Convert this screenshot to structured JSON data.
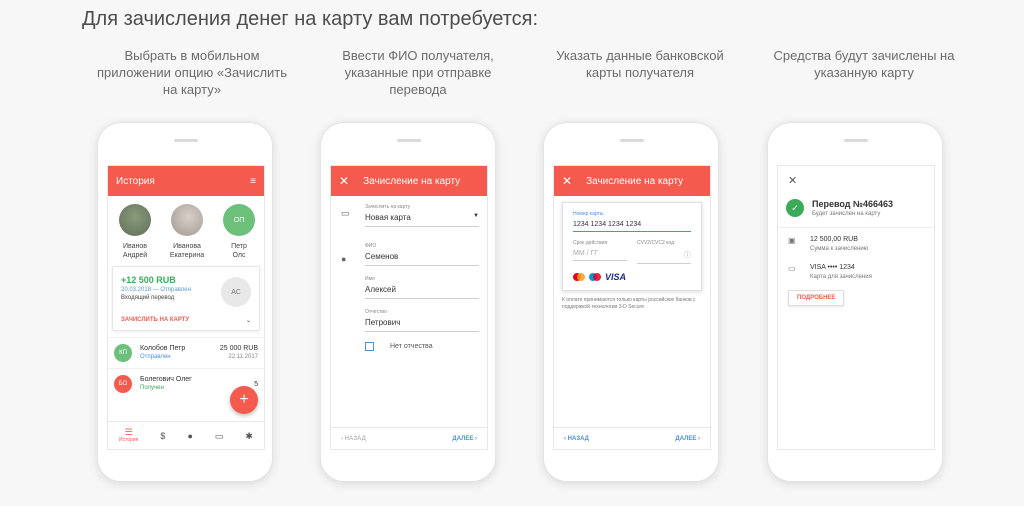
{
  "headline": "Для зачисления денег на карту вам потребуется:",
  "steps": [
    "Выбрать в мобильном приложении опцию «Зачислить на карту»",
    "Ввести ФИО получателя, указанные при отправке перевода",
    "Указать данные банковской карты получателя",
    "Средства будут зачислены на указанную карту"
  ],
  "screen1": {
    "title": "История",
    "contacts": [
      {
        "first": "Иванов",
        "last": "Андрей"
      },
      {
        "first": "Иванова",
        "last": "Екатерина"
      },
      {
        "first": "Петр",
        "last": "Олс"
      }
    ],
    "third_initials": "ОП",
    "card": {
      "amount": "+12 500 RUB",
      "date": "20.03.2018 — Отправлен",
      "sub": "Входящий перевод",
      "initials": "АС",
      "action": "ЗАЧИСЛИТЬ НА КАРТУ"
    },
    "rows": [
      {
        "initials": "КП",
        "name": "Колобов Петр",
        "status": "Отправлен",
        "amount": "25 000 RUB",
        "date": "22.11.2017",
        "color": "#6cc07a",
        "status_color": "#4a8fe0"
      },
      {
        "initials": "БО",
        "name": "Болегович Олег",
        "status": "Получен",
        "amount": "5",
        "date": "",
        "color": "#f55a4e",
        "status_color": "#3bab5a"
      }
    ],
    "tabs": [
      {
        "label": "История"
      }
    ]
  },
  "screen2": {
    "title": "Зачисление на карту",
    "fields": [
      {
        "label": "Зачислить на карту",
        "value": "Новая карта"
      },
      {
        "label": "ФИО",
        "value": "Семенов"
      },
      {
        "label": "Имя",
        "value": "Алексей"
      },
      {
        "label": "Отчество",
        "value": "Петрович"
      }
    ],
    "checkbox": "Нет отчества",
    "back": "НАЗАД",
    "next": "ДАЛЕЕ"
  },
  "screen3": {
    "title": "Зачисление на карту",
    "card_label": "Номер карты",
    "card_number": "1234 1234 1234 1234",
    "exp_label": "Срок действия",
    "exp_value": "ММ  /  ГГ",
    "cvv_label": "CVV2/CVC2 код",
    "brand": "VISA",
    "note": "К оплате принимаются только карты российских банков с поддержкой технологии 3-D Secure",
    "back": "НАЗАД",
    "next": "ДАЛЕЕ"
  },
  "screen4": {
    "transfer": "Перевод №466463",
    "transfer_sub": "Будет зачислен на карту",
    "amount": "12 500,00 RUB",
    "amount_sub": "Сумма к зачислению",
    "card": "VISA •••• 1234",
    "card_sub": "Карта для зачисления",
    "more": "ПОДРОБНЕЕ"
  },
  "colors": {
    "accent": "#f55a4e",
    "green": "#3bab5a",
    "blue": "#4a8fe0"
  }
}
